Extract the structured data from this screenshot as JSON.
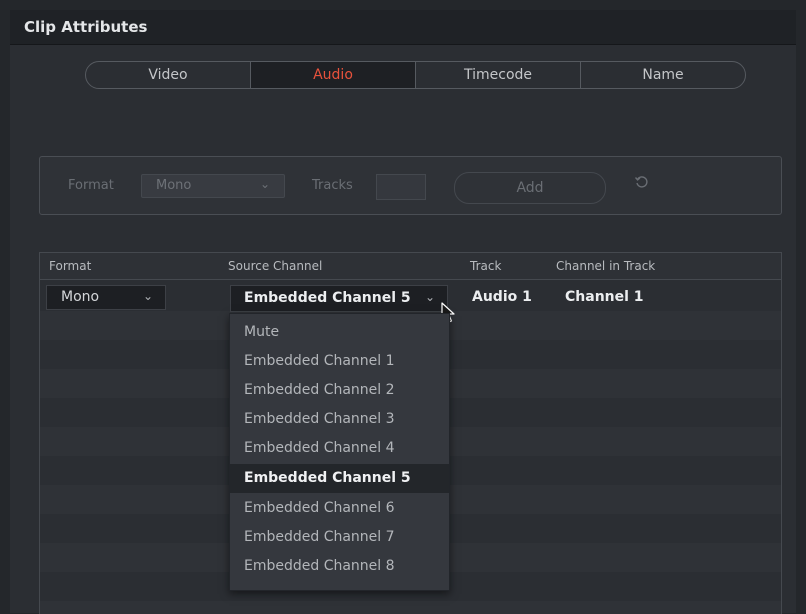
{
  "window": {
    "title": "Clip Attributes"
  },
  "tabs": [
    {
      "label": "Video",
      "active": false
    },
    {
      "label": "Audio",
      "active": true
    },
    {
      "label": "Timecode",
      "active": false
    },
    {
      "label": "Name",
      "active": false
    }
  ],
  "format_group": {
    "format_label": "Format",
    "format_value": "Mono",
    "tracks_label": "Tracks",
    "tracks_value": "",
    "add_label": "Add",
    "enabled": false
  },
  "table": {
    "headers": [
      "Format",
      "Source Channel",
      "Track",
      "Channel in Track"
    ],
    "rows": [
      {
        "format": "Mono",
        "source_channel": "Embedded Channel 5",
        "track": "Audio 1",
        "channel_in_track": "Channel 1"
      }
    ]
  },
  "source_dropdown": {
    "open": true,
    "options": [
      "Mute",
      "Embedded Channel 1",
      "Embedded Channel 2",
      "Embedded Channel 3",
      "Embedded Channel 4",
      "Embedded Channel 5",
      "Embedded Channel 6",
      "Embedded Channel 7",
      "Embedded Channel 8"
    ],
    "selected": "Embedded Channel 5"
  },
  "colors": {
    "accent_active_tab": "#e8523c",
    "background": "#2b2e33",
    "row_stripe": "#2f3237"
  },
  "icons": {
    "chevron": "chevron-down-icon",
    "reset": "reset-icon",
    "cursor": "mouse-pointer-icon"
  }
}
